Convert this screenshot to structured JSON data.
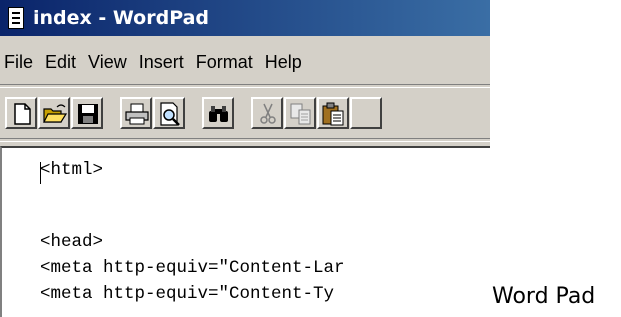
{
  "window": {
    "title": "index - WordPad",
    "title_icon": "wordpad-document-icon"
  },
  "menubar": {
    "items": [
      "File",
      "Edit",
      "View",
      "Insert",
      "Format",
      "Help"
    ]
  },
  "toolbar": {
    "buttons": [
      "new-icon",
      "open-icon",
      "save-icon",
      "print-icon",
      "print-preview-icon",
      "find-icon",
      "cut-icon",
      "copy-icon",
      "paste-icon"
    ]
  },
  "document": {
    "lines": [
      "<html>",
      "",
      "<head>",
      "<meta http-equiv=\"Content-Lar",
      "<meta http-equiv=\"Content-Ty"
    ]
  },
  "caption": "Word Pad",
  "colors": {
    "titlebar_start": "#0a246a",
    "titlebar_end": "#3a6ea5",
    "chrome": "#d4d0c8",
    "document_bg": "#ffffff"
  }
}
